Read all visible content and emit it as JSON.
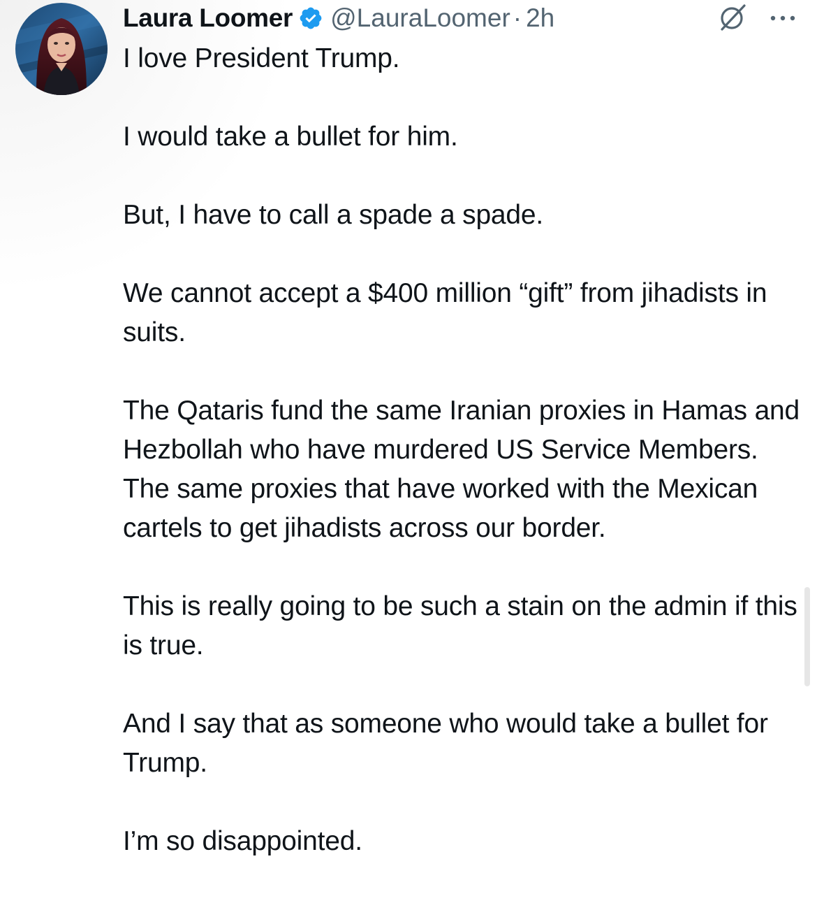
{
  "tweet": {
    "author": {
      "display_name": "Laura Loomer",
      "handle": "@LauraLoomer",
      "verified": true,
      "avatar_icon": "avatar-photo"
    },
    "separator": "·",
    "time": "2h",
    "grok_icon": "grok-icon",
    "more_icon": "more-options-icon",
    "paragraphs": [
      "I love President Trump.",
      "I would take a bullet for him.",
      "But, I have to call a spade a spade.",
      "We cannot accept a $400 million “gift” from jihadists in suits.",
      "The Qataris fund the same Iranian proxies in Hamas and Hezbollah who have murdered US Service Members. The same proxies that have worked with the Mexican cartels to get jihadists across our border.",
      "This is really going to be such a stain on the admin if this is true.",
      "And I say that as someone who would take a bullet for Trump.",
      "I’m so disappointed."
    ]
  },
  "colors": {
    "text": "#0f1419",
    "secondary": "#536471",
    "verified_blue": "#1d9bf0",
    "background": "#ffffff"
  }
}
